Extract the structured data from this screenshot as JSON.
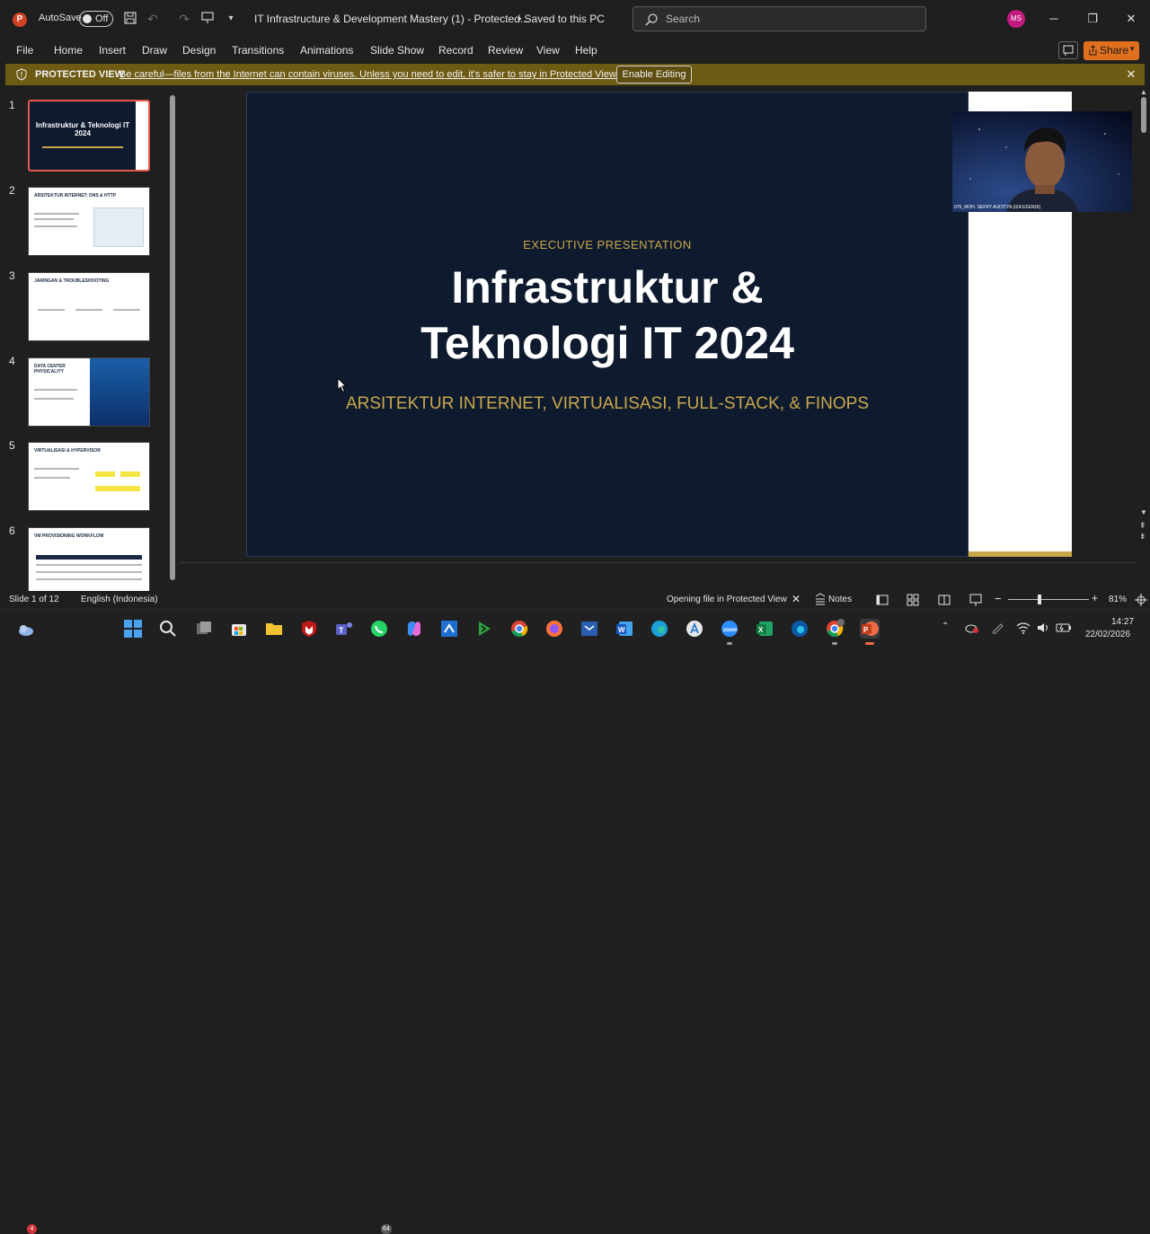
{
  "titlebar": {
    "autosave_label": "AutoSave",
    "autosave_state": "Off",
    "document_title": "IT Infrastructure & Development Mastery (1)  -  Protected...",
    "save_status": "•  Saved to this PC",
    "search_placeholder": "Search",
    "user_initials": "MS",
    "icons": [
      "powerpoint-logo",
      "save-icon",
      "undo-icon",
      "redo-icon",
      "present-icon",
      "customize-icon",
      "minimize-icon",
      "restore-icon",
      "close-icon"
    ]
  },
  "menu": {
    "items": [
      "File",
      "Home",
      "Insert",
      "Draw",
      "Design",
      "Transitions",
      "Animations",
      "Slide Show",
      "Record",
      "Review",
      "View",
      "Help"
    ],
    "share_label": "Share"
  },
  "protected_view": {
    "title": "PROTECTED VIEW",
    "message": "Be careful—files from the Internet can contain viruses. Unless you need to edit, it's safer to stay in Protected View.",
    "button": "Enable Editing",
    "bar_color": "#6d5a13"
  },
  "thumbnails": {
    "items": [
      {
        "num": "1",
        "title": "Infrastruktur & Teknologi IT 2024"
      },
      {
        "num": "2",
        "title": "ARSITEKTUR INTERNET: DNS & HTTP"
      },
      {
        "num": "3",
        "title": "JARINGAN & TROUBLESHOOTING"
      },
      {
        "num": "4",
        "title": "DATA CENTER PHYSICALITY"
      },
      {
        "num": "5",
        "title": "VIRTUALISASI & HYPERVISOR"
      },
      {
        "num": "6",
        "title": "VM PROVISIONING WORKFLOW"
      }
    ]
  },
  "slide": {
    "eyebrow": "EXECUTIVE PRESENTATION",
    "title_line1": "Infrastruktur &",
    "title_line2": "Teknologi IT 2024",
    "subtitle": "ARSITEKTUR INTERNET, VIRTUALISASI, FULL-STACK, & FINOPS",
    "background": "#0e1a2e",
    "accent": "#c9a84c"
  },
  "video": {
    "participant_name": "076_MOH. SEFRY AUDITYA (IZA EFENDI)"
  },
  "statusbar": {
    "slide_info": "Slide 1 of 12",
    "language": "English (Indonesia)",
    "status_message": "Opening file in Protected View",
    "notes_label": "Notes",
    "zoom": "81%",
    "zoom_level": 0.81
  },
  "taskbar": {
    "notification_count": "4",
    "whatsapp_badge": "64",
    "time": "14:27",
    "date": "22/02/2026",
    "apps": [
      "weather-icon",
      "start-icon",
      "search-icon",
      "task-view-icon",
      "store-icon",
      "file-explorer-icon",
      "mcafee-icon",
      "teams-icon",
      "whatsapp-icon",
      "copilot-icon",
      "vscode-icon",
      "terminal-icon",
      "chrome-icon",
      "firefox-icon",
      "remote-desktop-icon",
      "word-icon",
      "edge-icon",
      "app-store-icon",
      "zoom-icon",
      "excel-icon",
      "edge-dev-icon",
      "chrome-profile-icon",
      "powerpoint-icon"
    ]
  }
}
